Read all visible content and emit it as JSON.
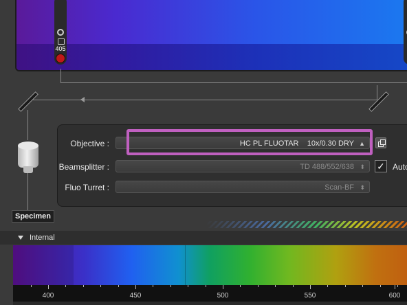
{
  "top_panel": {
    "left_slider_value": "405"
  },
  "objective_diagram": {
    "specimen_label": "Specimen"
  },
  "settings": {
    "objective": {
      "label": "Objective :",
      "value": "HC PL FLUOTAR    10x/0.30 DRY"
    },
    "beamsplitter": {
      "label": "Beamsplitter :",
      "value": "TD 488/552/638",
      "auto_label": "Auto",
      "auto_checked": true
    },
    "fluo_turret": {
      "label": "Fluo Turret :",
      "value": "Scan-BF"
    }
  },
  "internal_section": {
    "title": "Internal",
    "axis_ticks": [
      "400",
      "450",
      "500",
      "550",
      "600"
    ]
  },
  "colors": {
    "highlight": "#c060c0",
    "laser_dot": "#c01818"
  },
  "icons": [
    "chevron-updown-icon",
    "copy-icon",
    "checkmark-icon",
    "triangle-down-icon",
    "lock-icon",
    "objective-lens-icon"
  ]
}
